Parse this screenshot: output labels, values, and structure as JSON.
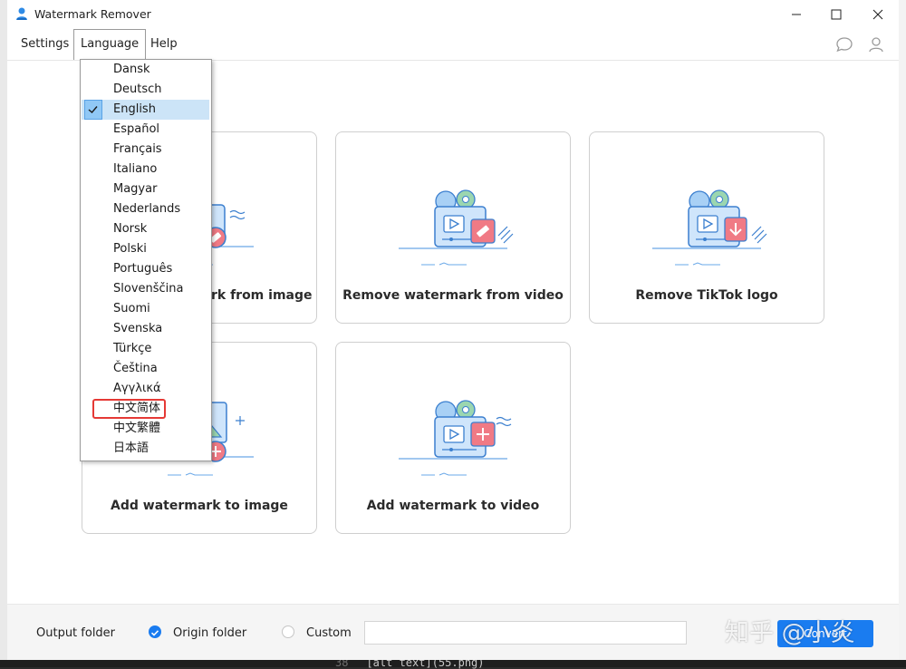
{
  "window": {
    "title": "Watermark Remover"
  },
  "menubar": {
    "settings": "Settings",
    "language": "Language",
    "help": "Help"
  },
  "language_menu": {
    "items": [
      "Dansk",
      "Deutsch",
      "English",
      "Español",
      "Français",
      "Italiano",
      "Magyar",
      "Nederlands",
      "Norsk",
      "Polski",
      "Português",
      "Slovenščina",
      "Suomi",
      "Svenska",
      "Türkçe",
      "Čeština",
      "Αγγλικά",
      "中文简体",
      "中文繁體",
      "日本語"
    ],
    "selected": "English",
    "highlighted": "中文简体"
  },
  "cards": {
    "remove_image": "Remove watermark from image",
    "remove_image_visible": "rk from image",
    "remove_video": "Remove watermark from video",
    "remove_tiktok": "Remove TikTok logo",
    "add_image": "Add watermark to image",
    "add_video": "Add watermark to video"
  },
  "footer": {
    "output_folder": "Output folder",
    "origin_folder": "Origin folder",
    "custom": "Custom",
    "path_value": "",
    "convert": "Convert"
  },
  "overlay": {
    "watermark_text": "知乎 @小炎"
  },
  "background": {
    "code_line_no": "38",
    "code_text": "[alt text](55.png)"
  },
  "colors": {
    "accent": "#1a7cf0",
    "highlight_red": "#e53935",
    "illustration_blue": "#a8d0f5",
    "illustration_red": "#f07a85"
  }
}
